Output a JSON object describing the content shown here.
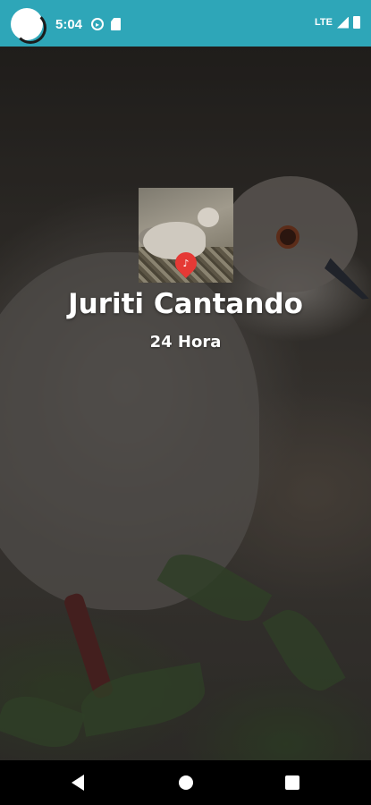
{
  "status_bar": {
    "time": "5:04",
    "network": "LTE",
    "icons": [
      "app-bubble-icon",
      "play-protect-icon",
      "sd-card-icon",
      "signal-icon",
      "battery-icon"
    ],
    "color": "#2ea6b8"
  },
  "player": {
    "title": "Juriti Cantando",
    "subtitle": "24 Hora",
    "thumbnail": "dove-thumbnail",
    "badge_icon": "map-pin-icon"
  },
  "nav_bar": {
    "icons": [
      "back-icon",
      "home-icon",
      "recents-icon"
    ]
  }
}
